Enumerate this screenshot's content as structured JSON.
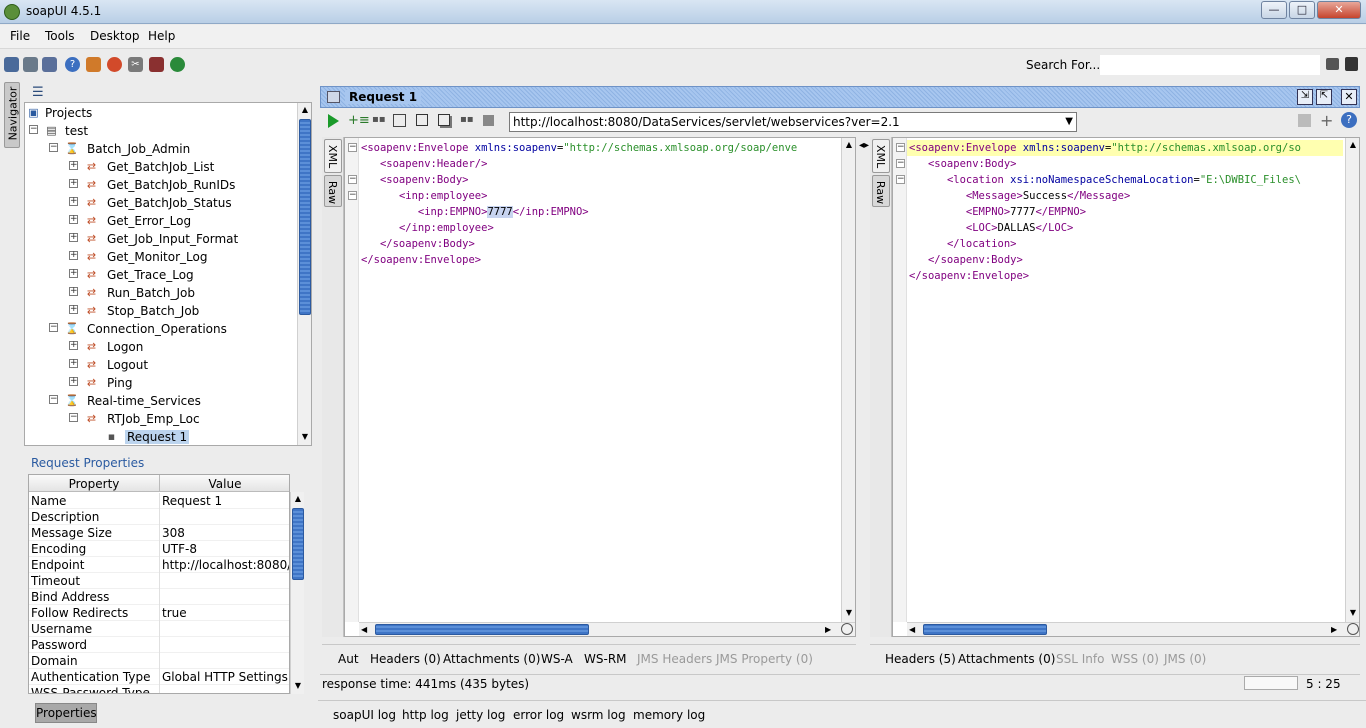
{
  "window": {
    "title": "soapUI 4.5.1",
    "min": "—",
    "max": "□",
    "close": "✕"
  },
  "menu": [
    "File",
    "Tools",
    "Desktop",
    "Help"
  ],
  "search": {
    "label": "Search For...",
    "value": ""
  },
  "navigator": {
    "label": "Navigator"
  },
  "tree": {
    "root": "Projects",
    "project": "test",
    "items": [
      {
        "label": "Batch_Job_Admin",
        "level": 2,
        "kind": "interface"
      },
      {
        "label": "Get_BatchJob_List",
        "level": 3,
        "kind": "operation"
      },
      {
        "label": "Get_BatchJob_RunIDs",
        "level": 3,
        "kind": "operation"
      },
      {
        "label": "Get_BatchJob_Status",
        "level": 3,
        "kind": "operation"
      },
      {
        "label": "Get_Error_Log",
        "level": 3,
        "kind": "operation"
      },
      {
        "label": "Get_Job_Input_Format",
        "level": 3,
        "kind": "operation"
      },
      {
        "label": "Get_Monitor_Log",
        "level": 3,
        "kind": "operation"
      },
      {
        "label": "Get_Trace_Log",
        "level": 3,
        "kind": "operation"
      },
      {
        "label": "Run_Batch_Job",
        "level": 3,
        "kind": "operation"
      },
      {
        "label": "Stop_Batch_Job",
        "level": 3,
        "kind": "operation"
      },
      {
        "label": "Connection_Operations",
        "level": 2,
        "kind": "interface"
      },
      {
        "label": "Logon",
        "level": 3,
        "kind": "operation"
      },
      {
        "label": "Logout",
        "level": 3,
        "kind": "operation"
      },
      {
        "label": "Ping",
        "level": 3,
        "kind": "operation"
      },
      {
        "label": "Real-time_Services",
        "level": 2,
        "kind": "interface"
      },
      {
        "label": "RTJob_Emp_Loc",
        "level": 3,
        "kind": "operation"
      },
      {
        "label": "Request 1",
        "level": 4,
        "kind": "request"
      }
    ]
  },
  "properties": {
    "title": "Request Properties",
    "headers": [
      "Property",
      "Value"
    ],
    "rows": [
      [
        "Name",
        "Request 1"
      ],
      [
        "Description",
        ""
      ],
      [
        "Message Size",
        "308"
      ],
      [
        "Encoding",
        "UTF-8"
      ],
      [
        "Endpoint",
        "http://localhost:8080/..."
      ],
      [
        "Timeout",
        ""
      ],
      [
        "Bind Address",
        ""
      ],
      [
        "Follow Redirects",
        "true"
      ],
      [
        "Username",
        ""
      ],
      [
        "Password",
        ""
      ],
      [
        "Domain",
        ""
      ],
      [
        "Authentication Type",
        "Global HTTP Settings"
      ],
      [
        "WSS-Password Type",
        ""
      ]
    ],
    "tab": "Properties"
  },
  "request": {
    "title": "Request 1",
    "endpoint": "http://localhost:8080/DataServices/servlet/webservices?ver=2.1",
    "side_tabs": [
      "XML",
      "Raw"
    ],
    "bottom_tabs": [
      "Aut",
      "Headers (0)",
      "Attachments (0)",
      "WS-A",
      "WS-RM",
      "JMS Headers",
      "JMS Property (0)"
    ]
  },
  "response": {
    "side_tabs": [
      "XML",
      "Raw"
    ],
    "bottom_tabs": [
      "Headers (5)",
      "Attachments (0)",
      "SSL Info",
      "WSS (0)",
      "JMS (0)"
    ]
  },
  "status": {
    "text": "response time: 441ms (435 bytes)",
    "position": "5 : 25"
  },
  "log_tabs": [
    "soapUI log",
    "http log",
    "jetty log",
    "error log",
    "wsrm log",
    "memory log"
  ],
  "colors": {
    "accent": "#3f75c6",
    "tag": "#800080",
    "attr": "#0000a0",
    "value": "#2a8f2a"
  }
}
